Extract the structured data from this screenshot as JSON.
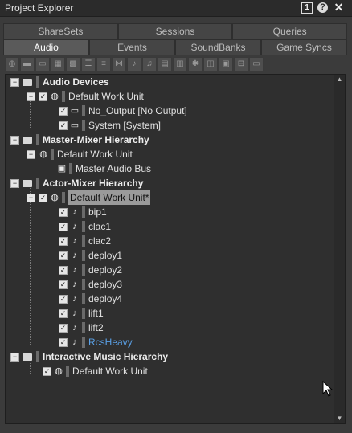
{
  "window": {
    "title": "Project Explorer",
    "number_badge": "1",
    "help_glyph": "?",
    "close_glyph": "✕"
  },
  "tabs_top": [
    "ShareSets",
    "Sessions",
    "Queries"
  ],
  "tabs_bottom": [
    "Audio",
    "Events",
    "SoundBanks",
    "Game Syncs"
  ],
  "active_tab": "Audio",
  "tree": {
    "audio_devices": "Audio Devices",
    "default_work_unit": "Default Work Unit",
    "no_output": "No_Output [No Output]",
    "system": "System [System]",
    "master_mixer": "Master-Mixer Hierarchy",
    "mm_default_work_unit": "Default Work Unit",
    "master_audio_bus": "Master Audio Bus",
    "actor_mixer": "Actor-Mixer Hierarchy",
    "am_default_work_unit": "Default Work Unit*",
    "sounds": [
      "bip1",
      "clac1",
      "clac2",
      "deploy1",
      "deploy2",
      "deploy3",
      "deploy4",
      "lift1",
      "lift2",
      "RcsHeavy"
    ],
    "interactive_music": "Interactive Music Hierarchy",
    "im_default_work_unit": "Default Work Unit"
  },
  "glyphs": {
    "collapse": "−",
    "check": "✓"
  },
  "icons": {
    "work_unit": "work-unit-icon",
    "device": "audio-device-icon",
    "bus": "bus-icon",
    "sound": "sound-sfx-icon",
    "folder": "folder-icon"
  },
  "colors": {
    "accent_blue": "#5aa0e6",
    "selection": "#9a9a9a",
    "background": "#2f2f2f"
  }
}
